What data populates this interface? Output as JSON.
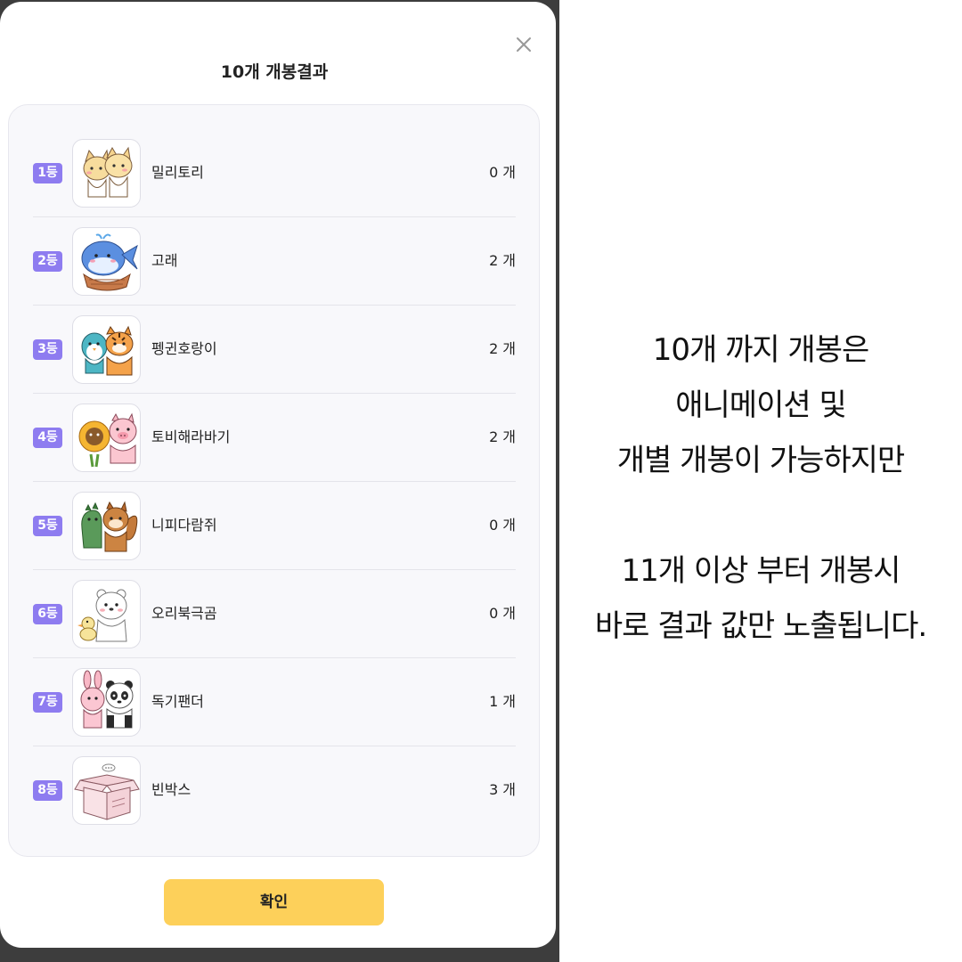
{
  "modal": {
    "title": "10개 개봉결과",
    "confirm_label": "확인",
    "count_unit": "개",
    "items": [
      {
        "rank": "1등",
        "name": "밀리토리",
        "count": "0",
        "image": "two-cream-cats-sticker"
      },
      {
        "rank": "2등",
        "name": "고래",
        "count": "2",
        "image": "blue-whale-in-basket-sticker"
      },
      {
        "rank": "3등",
        "name": "펭귄호랑이",
        "count": "2",
        "image": "penguin-and-tiger-sticker"
      },
      {
        "rank": "4등",
        "name": "토비해라바기",
        "count": "2",
        "image": "sunflower-and-pig-sticker"
      },
      {
        "rank": "5등",
        "name": "니피다람쥐",
        "count": "0",
        "image": "dino-and-squirrel-sticker"
      },
      {
        "rank": "6등",
        "name": "오리북극곰",
        "count": "0",
        "image": "duck-and-polar-bear-sticker"
      },
      {
        "rank": "7등",
        "name": "독기팬더",
        "count": "1",
        "image": "bunny-and-panda-sticker"
      },
      {
        "rank": "8등",
        "name": "빈박스",
        "count": "3",
        "image": "empty-box-sticker"
      }
    ]
  },
  "caption": {
    "lines": [
      "10개 까지 개봉은",
      "애니메이션 및",
      "개별 개봉이 가능하지만",
      "",
      "11개 이상 부터 개봉시",
      "바로 결과 값만 노출됩니다."
    ]
  },
  "colors": {
    "rank_badge": "#8e7cf0",
    "confirm_button": "#fdd05a",
    "backdrop": "#3d3d3d"
  }
}
